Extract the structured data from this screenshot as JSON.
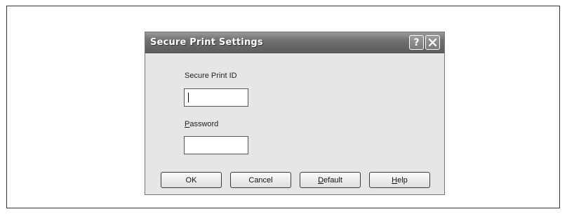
{
  "dialog": {
    "title": "Secure Print Settings",
    "title_buttons": {
      "help_glyph": "?",
      "help_icon": "question-icon",
      "close_icon": "close-icon"
    }
  },
  "fields": {
    "secure_print_id": {
      "label": "Secure Print ID",
      "value": ""
    },
    "password": {
      "label_mnemonic": "P",
      "label_rest": "assword",
      "value": ""
    }
  },
  "buttons": {
    "ok": "OK",
    "cancel": "Cancel",
    "default_mnemonic": "D",
    "default_rest": "efault",
    "help_mnemonic": "H",
    "help_rest": "elp"
  }
}
